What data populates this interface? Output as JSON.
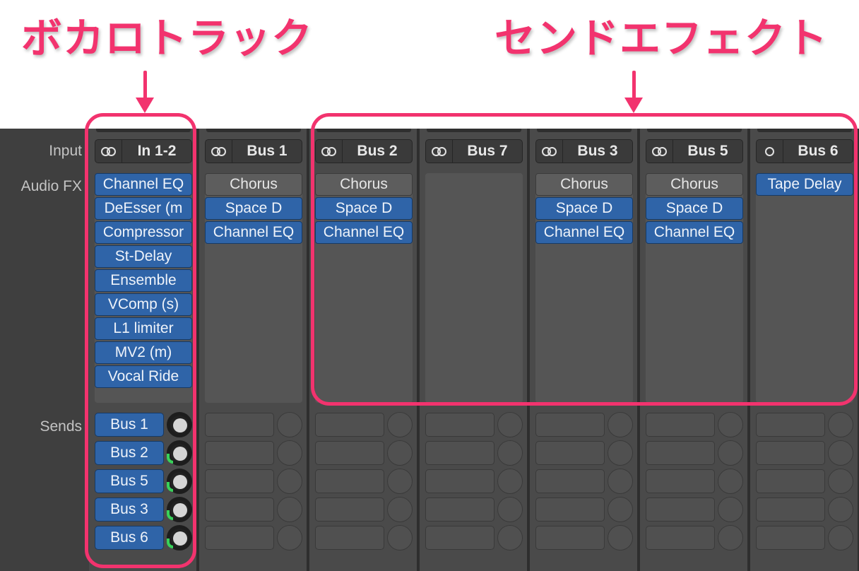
{
  "annotations": {
    "vocal_track_title": "ボカロトラック",
    "send_effect_title": "センドエフェクト",
    "accent_color": "#f2336e"
  },
  "row_labels": {
    "input": "Input",
    "audio_fx": "Audio FX",
    "sends": "Sends"
  },
  "strips": [
    {
      "input": "In 1-2",
      "input_icon": "stereo-icon",
      "fx": [
        {
          "label": "Channel EQ",
          "style": "blue"
        },
        {
          "label": "DeEsser (m",
          "style": "blue"
        },
        {
          "label": "Compressor",
          "style": "blue"
        },
        {
          "label": "St-Delay",
          "style": "blue"
        },
        {
          "label": "Ensemble",
          "style": "blue"
        },
        {
          "label": "VComp (s)",
          "style": "blue"
        },
        {
          "label": "L1 limiter",
          "style": "blue"
        },
        {
          "label": "MV2 (m)",
          "style": "blue"
        },
        {
          "label": "Vocal Ride",
          "style": "blue"
        }
      ],
      "sends": [
        {
          "label": "Bus 1",
          "level": 0.0
        },
        {
          "label": "Bus 2",
          "level": 0.2
        },
        {
          "label": "Bus 5",
          "level": 0.2
        },
        {
          "label": "Bus 3",
          "level": 0.25
        },
        {
          "label": "Bus 6",
          "level": 0.25
        }
      ]
    },
    {
      "input": "Bus 1",
      "input_icon": "stereo-icon",
      "fx": [
        {
          "label": "Chorus",
          "style": "gray"
        },
        {
          "label": "Space D",
          "style": "blue"
        },
        {
          "label": "Channel EQ",
          "style": "blue"
        }
      ],
      "sends": []
    },
    {
      "input": "Bus 2",
      "input_icon": "stereo-icon",
      "fx": [
        {
          "label": "Chorus",
          "style": "gray"
        },
        {
          "label": "Space D",
          "style": "blue"
        },
        {
          "label": "Channel EQ",
          "style": "blue"
        }
      ],
      "sends": []
    },
    {
      "input": "Bus 7",
      "input_icon": "stereo-icon",
      "fx": [],
      "sends": []
    },
    {
      "input": "Bus 3",
      "input_icon": "stereo-icon",
      "fx": [
        {
          "label": "Chorus",
          "style": "gray"
        },
        {
          "label": "Space D",
          "style": "blue"
        },
        {
          "label": "Channel EQ",
          "style": "blue"
        }
      ],
      "sends": []
    },
    {
      "input": "Bus 5",
      "input_icon": "stereo-icon",
      "fx": [
        {
          "label": "Chorus",
          "style": "gray"
        },
        {
          "label": "Space D",
          "style": "blue"
        },
        {
          "label": "Channel EQ",
          "style": "blue"
        }
      ],
      "sends": []
    },
    {
      "input": "Bus 6",
      "input_icon": "mono-icon",
      "fx": [
        {
          "label": "Tape Delay",
          "style": "blue"
        }
      ],
      "sends": []
    }
  ]
}
